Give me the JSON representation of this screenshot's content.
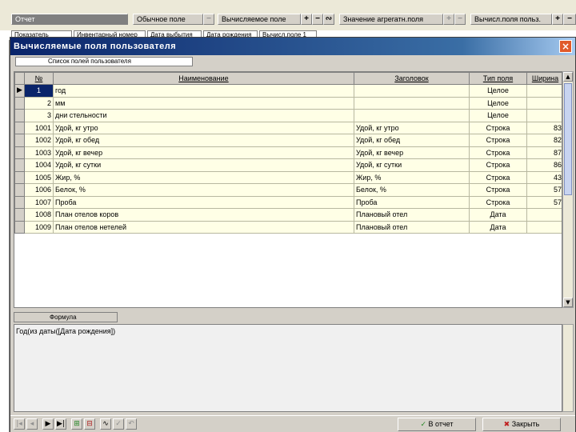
{
  "toolbar": {
    "seg_report": "Отчет",
    "seg_normal": "Обычное поле",
    "seg_calc": "Вычисляемое поле",
    "seg_agg": "Значение агрегатн.поля",
    "seg_user": "Вычисл.поля польз.",
    "add_label": "+",
    "remove_label": "−",
    "link_label": "∾"
  },
  "tabs": [
    "Показатель",
    "Инвентарный номер",
    "Дата выбытия",
    "Дата рождения",
    "Вычисл.поле 1"
  ],
  "dialog": {
    "title": "Вычисляемые поля пользователя",
    "close_label": "×",
    "list_tab": "Список полей пользователя",
    "columns": [
      "№",
      "Наименование",
      "Заголовок",
      "Тип поля",
      "Ширина"
    ],
    "rows": [
      {
        "num": "1",
        "name": "год",
        "header": "",
        "type": "Целое",
        "width": ""
      },
      {
        "num": "2",
        "name": "мм",
        "header": "",
        "type": "Целое",
        "width": ""
      },
      {
        "num": "3",
        "name": "дни стельности",
        "header": "",
        "type": "Целое",
        "width": ""
      },
      {
        "num": "1001",
        "name": "Удой, кг утро",
        "header": "Удой, кг утро",
        "type": "Строка",
        "width": "83"
      },
      {
        "num": "1002",
        "name": "Удой, кг обед",
        "header": "Удой, кг обед",
        "type": "Строка",
        "width": "82"
      },
      {
        "num": "1003",
        "name": "Удой, кг вечер",
        "header": "Удой, кг вечер",
        "type": "Строка",
        "width": "87"
      },
      {
        "num": "1004",
        "name": "Удой, кг сутки",
        "header": "Удой, кг сутки",
        "type": "Строка",
        "width": "86"
      },
      {
        "num": "1005",
        "name": "Жир, %",
        "header": "Жир, %",
        "type": "Строка",
        "width": "43"
      },
      {
        "num": "1006",
        "name": "Белок, %",
        "header": "Белок, %",
        "type": "Строка",
        "width": "57"
      },
      {
        "num": "1007",
        "name": "Проба",
        "header": "Проба",
        "type": "Строка",
        "width": "57"
      },
      {
        "num": "1008",
        "name": "План отелов коров",
        "header": "Плановый отел",
        "type": "Дата",
        "width": ""
      },
      {
        "num": "1009",
        "name": "План отелов нетелей",
        "header": "Плановый отел",
        "type": "Дата",
        "width": ""
      }
    ],
    "formula_tab": "Формула",
    "formula_text": "Год(из даты([Дата рождения])",
    "ok_label": "В отчет",
    "close_btn_label": "Закрыть",
    "colors": {
      "title_start": "#0a246a",
      "title_end": "#a6caf0",
      "grid_bg": "#ffffe6",
      "selection": "#0a246a"
    }
  }
}
